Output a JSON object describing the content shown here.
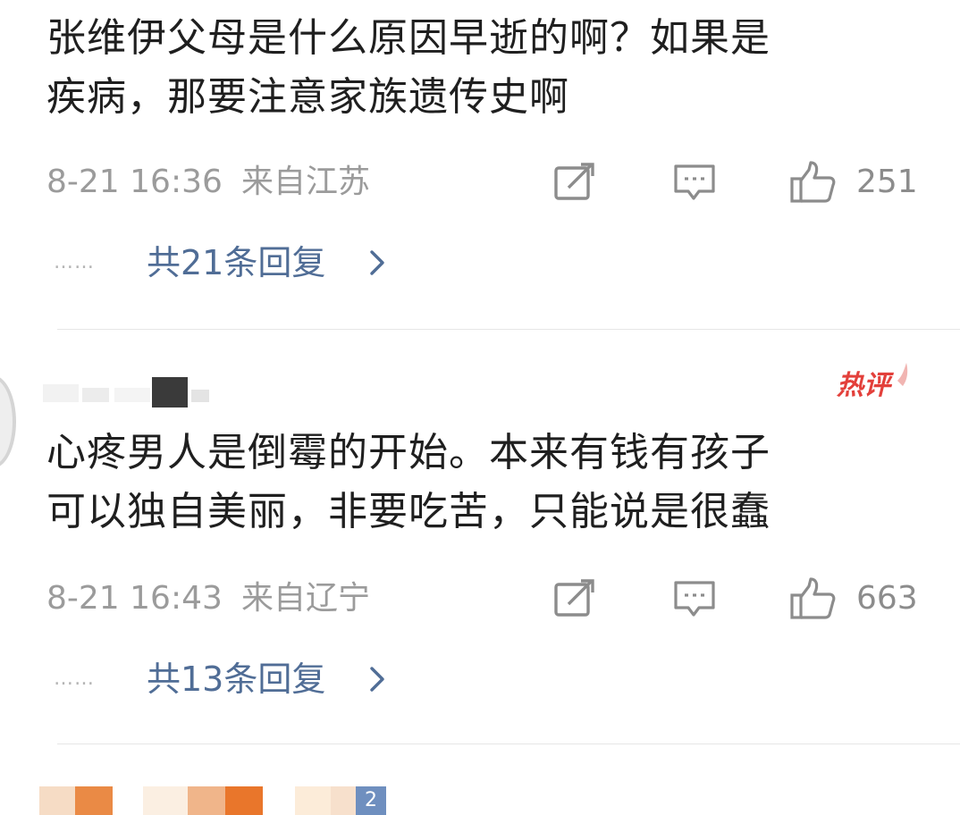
{
  "comments": [
    {
      "text": "张维伊父母是什么原因早逝的啊？如果是\n疾病，那要注意家族遗传史啊",
      "time": "8-21 16:36",
      "location": "来自江苏",
      "likes": "251",
      "replies_dots": "……",
      "replies_label": "共21条回复"
    },
    {
      "badge": "热评",
      "text": "心疼男人是倒霉的开始。本来有钱有孩子\n可以独自美丽，非要吃苦，只能说是很蠢",
      "time": "8-21 16:43",
      "location": "来自辽宁",
      "likes": "663",
      "replies_dots": "……",
      "replies_label": "共13条回复"
    }
  ],
  "bottom_strip": {
    "count_fragment": "2"
  },
  "icons": {
    "repost": "repost-icon",
    "comment": "comment-icon",
    "like": "thumbs-up-icon",
    "chevron": "chevron-right-icon"
  },
  "colors": {
    "text": "#1f1f1f",
    "meta": "#9b9b9b",
    "link": "#506d96",
    "hot_badge": "#e3403b",
    "divider": "#e6e6e6"
  }
}
